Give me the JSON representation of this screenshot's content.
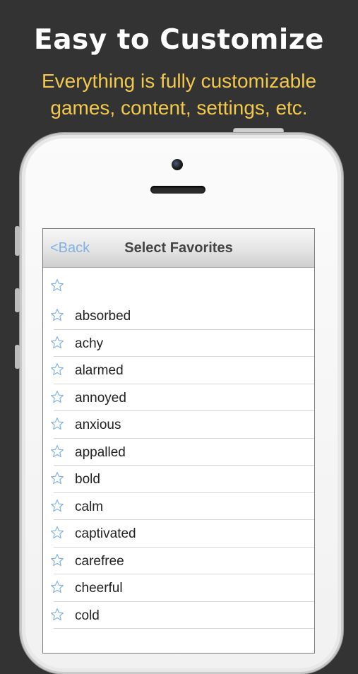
{
  "promo": {
    "headline": "Easy to Customize",
    "subline_1": "Everything is fully customizable",
    "subline_2": "games, content, settings, etc."
  },
  "navbar": {
    "back_label": "<Back",
    "title": "Select Favorites"
  },
  "list": {
    "icon": "star-outline-icon",
    "items": [
      "",
      "absorbed",
      "achy",
      "alarmed",
      "annoyed",
      "anxious",
      "appalled",
      "bold",
      "calm",
      "captivated",
      "carefree",
      "cheerful",
      "cold"
    ]
  },
  "colors": {
    "background": "#333333",
    "headline": "#ffffff",
    "subline": "#f2c94c",
    "back_link": "#7fb2e3",
    "star": "#7fb2e3"
  }
}
